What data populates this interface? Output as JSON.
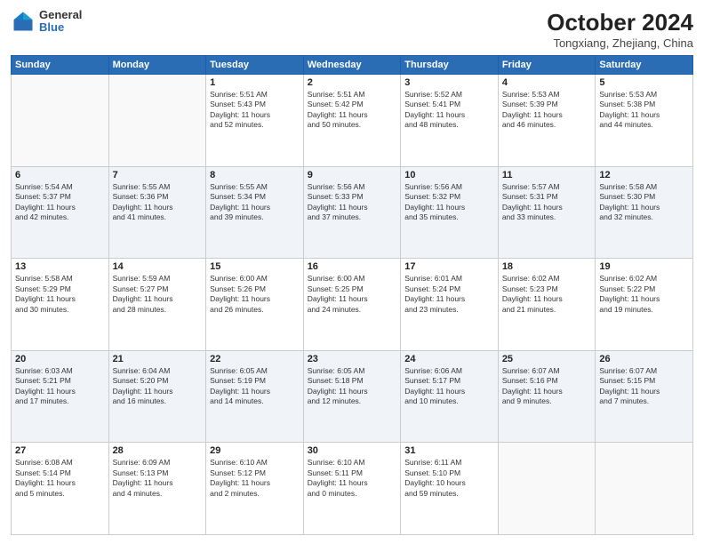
{
  "logo": {
    "line1": "General",
    "line2": "Blue"
  },
  "title": "October 2024",
  "location": "Tongxiang, Zhejiang, China",
  "weekdays": [
    "Sunday",
    "Monday",
    "Tuesday",
    "Wednesday",
    "Thursday",
    "Friday",
    "Saturday"
  ],
  "weeks": [
    [
      {
        "day": "",
        "text": ""
      },
      {
        "day": "",
        "text": ""
      },
      {
        "day": "1",
        "text": "Sunrise: 5:51 AM\nSunset: 5:43 PM\nDaylight: 11 hours\nand 52 minutes."
      },
      {
        "day": "2",
        "text": "Sunrise: 5:51 AM\nSunset: 5:42 PM\nDaylight: 11 hours\nand 50 minutes."
      },
      {
        "day": "3",
        "text": "Sunrise: 5:52 AM\nSunset: 5:41 PM\nDaylight: 11 hours\nand 48 minutes."
      },
      {
        "day": "4",
        "text": "Sunrise: 5:53 AM\nSunset: 5:39 PM\nDaylight: 11 hours\nand 46 minutes."
      },
      {
        "day": "5",
        "text": "Sunrise: 5:53 AM\nSunset: 5:38 PM\nDaylight: 11 hours\nand 44 minutes."
      }
    ],
    [
      {
        "day": "6",
        "text": "Sunrise: 5:54 AM\nSunset: 5:37 PM\nDaylight: 11 hours\nand 42 minutes."
      },
      {
        "day": "7",
        "text": "Sunrise: 5:55 AM\nSunset: 5:36 PM\nDaylight: 11 hours\nand 41 minutes."
      },
      {
        "day": "8",
        "text": "Sunrise: 5:55 AM\nSunset: 5:34 PM\nDaylight: 11 hours\nand 39 minutes."
      },
      {
        "day": "9",
        "text": "Sunrise: 5:56 AM\nSunset: 5:33 PM\nDaylight: 11 hours\nand 37 minutes."
      },
      {
        "day": "10",
        "text": "Sunrise: 5:56 AM\nSunset: 5:32 PM\nDaylight: 11 hours\nand 35 minutes."
      },
      {
        "day": "11",
        "text": "Sunrise: 5:57 AM\nSunset: 5:31 PM\nDaylight: 11 hours\nand 33 minutes."
      },
      {
        "day": "12",
        "text": "Sunrise: 5:58 AM\nSunset: 5:30 PM\nDaylight: 11 hours\nand 32 minutes."
      }
    ],
    [
      {
        "day": "13",
        "text": "Sunrise: 5:58 AM\nSunset: 5:29 PM\nDaylight: 11 hours\nand 30 minutes."
      },
      {
        "day": "14",
        "text": "Sunrise: 5:59 AM\nSunset: 5:27 PM\nDaylight: 11 hours\nand 28 minutes."
      },
      {
        "day": "15",
        "text": "Sunrise: 6:00 AM\nSunset: 5:26 PM\nDaylight: 11 hours\nand 26 minutes."
      },
      {
        "day": "16",
        "text": "Sunrise: 6:00 AM\nSunset: 5:25 PM\nDaylight: 11 hours\nand 24 minutes."
      },
      {
        "day": "17",
        "text": "Sunrise: 6:01 AM\nSunset: 5:24 PM\nDaylight: 11 hours\nand 23 minutes."
      },
      {
        "day": "18",
        "text": "Sunrise: 6:02 AM\nSunset: 5:23 PM\nDaylight: 11 hours\nand 21 minutes."
      },
      {
        "day": "19",
        "text": "Sunrise: 6:02 AM\nSunset: 5:22 PM\nDaylight: 11 hours\nand 19 minutes."
      }
    ],
    [
      {
        "day": "20",
        "text": "Sunrise: 6:03 AM\nSunset: 5:21 PM\nDaylight: 11 hours\nand 17 minutes."
      },
      {
        "day": "21",
        "text": "Sunrise: 6:04 AM\nSunset: 5:20 PM\nDaylight: 11 hours\nand 16 minutes."
      },
      {
        "day": "22",
        "text": "Sunrise: 6:05 AM\nSunset: 5:19 PM\nDaylight: 11 hours\nand 14 minutes."
      },
      {
        "day": "23",
        "text": "Sunrise: 6:05 AM\nSunset: 5:18 PM\nDaylight: 11 hours\nand 12 minutes."
      },
      {
        "day": "24",
        "text": "Sunrise: 6:06 AM\nSunset: 5:17 PM\nDaylight: 11 hours\nand 10 minutes."
      },
      {
        "day": "25",
        "text": "Sunrise: 6:07 AM\nSunset: 5:16 PM\nDaylight: 11 hours\nand 9 minutes."
      },
      {
        "day": "26",
        "text": "Sunrise: 6:07 AM\nSunset: 5:15 PM\nDaylight: 11 hours\nand 7 minutes."
      }
    ],
    [
      {
        "day": "27",
        "text": "Sunrise: 6:08 AM\nSunset: 5:14 PM\nDaylight: 11 hours\nand 5 minutes."
      },
      {
        "day": "28",
        "text": "Sunrise: 6:09 AM\nSunset: 5:13 PM\nDaylight: 11 hours\nand 4 minutes."
      },
      {
        "day": "29",
        "text": "Sunrise: 6:10 AM\nSunset: 5:12 PM\nDaylight: 11 hours\nand 2 minutes."
      },
      {
        "day": "30",
        "text": "Sunrise: 6:10 AM\nSunset: 5:11 PM\nDaylight: 11 hours\nand 0 minutes."
      },
      {
        "day": "31",
        "text": "Sunrise: 6:11 AM\nSunset: 5:10 PM\nDaylight: 10 hours\nand 59 minutes."
      },
      {
        "day": "",
        "text": ""
      },
      {
        "day": "",
        "text": ""
      }
    ]
  ]
}
